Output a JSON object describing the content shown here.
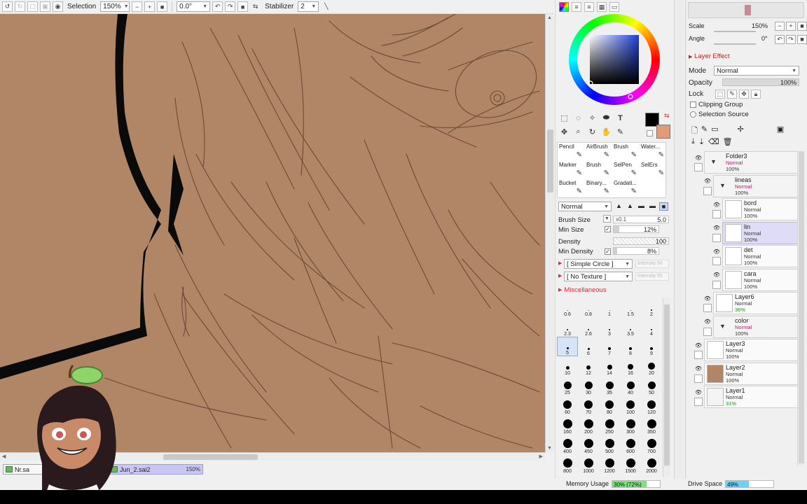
{
  "toolbar": {
    "selection_label": "Selection",
    "zoom_value": "150%",
    "rotation_value": "0.0°",
    "stabilizer_label": "Stabilizer",
    "stabilizer_value": "2"
  },
  "color_panel": {
    "fg_color": "#000000",
    "bg_color": "#e29a78",
    "canvas_color": "#b18667"
  },
  "brush_tools": [
    {
      "label": "Pencil"
    },
    {
      "label": "AirBrush"
    },
    {
      "label": "Brush"
    },
    {
      "label": "Water..."
    },
    {
      "label": "Marker"
    },
    {
      "label": "Brush"
    },
    {
      "label": "SelPen"
    },
    {
      "label": "SelErs"
    },
    {
      "label": "Bucket"
    },
    {
      "label": "Binary..."
    },
    {
      "label": "Gradati..."
    },
    {
      "label": ""
    }
  ],
  "brush_settings": {
    "blend_mode": "Normal",
    "brush_size_label": "Brush Size",
    "brush_size_multiplier": "x0.1",
    "brush_size_value": "5.0",
    "min_size_label": "Min Size",
    "min_size_value": "12%",
    "density_label": "Density",
    "density_value": "100",
    "min_density_label": "Min Density",
    "min_density_value": "8%",
    "shape_label": "[ Simple Circle ]",
    "shape_intensity": "Intensity 50",
    "texture_label": "[ No Texture ]",
    "texture_intensity": "Intensity 95",
    "misc_label": "Miscellaneous"
  },
  "brush_sizes": [
    {
      "label": "0.6",
      "d": 1
    },
    {
      "label": "0.8",
      "d": 1
    },
    {
      "label": "1",
      "d": 1
    },
    {
      "label": "1.5",
      "d": 1
    },
    {
      "label": "2",
      "d": 2
    },
    {
      "label": "2.3",
      "d": 2
    },
    {
      "label": "2.6",
      "d": 2
    },
    {
      "label": "3",
      "d": 2
    },
    {
      "label": "3.5",
      "d": 2
    },
    {
      "label": "4",
      "d": 2
    },
    {
      "label": "5",
      "d": 3
    },
    {
      "label": "6",
      "d": 3
    },
    {
      "label": "7",
      "d": 4
    },
    {
      "label": "8",
      "d": 4
    },
    {
      "label": "9",
      "d": 4
    },
    {
      "label": "10",
      "d": 5
    },
    {
      "label": "12",
      "d": 6
    },
    {
      "label": "14",
      "d": 7
    },
    {
      "label": "16",
      "d": 8
    },
    {
      "label": "20",
      "d": 10
    },
    {
      "label": "25",
      "d": 11
    },
    {
      "label": "30",
      "d": 11
    },
    {
      "label": "35",
      "d": 11
    },
    {
      "label": "40",
      "d": 11
    },
    {
      "label": "50",
      "d": 11
    },
    {
      "label": "60",
      "d": 12
    },
    {
      "label": "70",
      "d": 12
    },
    {
      "label": "80",
      "d": 12
    },
    {
      "label": "100",
      "d": 12
    },
    {
      "label": "120",
      "d": 12
    },
    {
      "label": "160",
      "d": 13
    },
    {
      "label": "200",
      "d": 13
    },
    {
      "label": "250",
      "d": 13
    },
    {
      "label": "300",
      "d": 13
    },
    {
      "label": "350",
      "d": 13
    },
    {
      "label": "400",
      "d": 13
    },
    {
      "label": "450",
      "d": 13
    },
    {
      "label": "500",
      "d": 13
    },
    {
      "label": "600",
      "d": 13
    },
    {
      "label": "700",
      "d": 13
    },
    {
      "label": "800",
      "d": 13
    },
    {
      "label": "1000",
      "d": 13
    },
    {
      "label": "1200",
      "d": 13
    },
    {
      "label": "1500",
      "d": 13
    },
    {
      "label": "2000",
      "d": 13
    }
  ],
  "navigator": {
    "scale_label": "Scale",
    "scale_value": "150%",
    "angle_label": "Angle",
    "angle_value": "0°"
  },
  "layer_props": {
    "layer_effect_label": "Layer Effect",
    "mode_label": "Mode",
    "mode_value": "Normal",
    "opacity_label": "Opacity",
    "opacity_value": "100%",
    "lock_label": "Lock",
    "clipping_label": "Clipping Group",
    "selection_source_label": "Selection Source"
  },
  "layers": [
    {
      "name": "Folder3",
      "mode": "Normal",
      "opacity": "100%",
      "folder": true,
      "selected": false
    },
    {
      "name": "lineas",
      "mode": "Normal",
      "opacity": "100%",
      "folder": true,
      "selected": false
    },
    {
      "name": "bord",
      "mode": "Normal",
      "opacity": "100%",
      "folder": false,
      "selected": false
    },
    {
      "name": "lin",
      "mode": "Normal",
      "opacity": "100%",
      "folder": false,
      "selected": true
    },
    {
      "name": "det",
      "mode": "Normal",
      "opacity": "100%",
      "folder": false,
      "selected": false
    },
    {
      "name": "cara",
      "mode": "Normal",
      "opacity": "100%",
      "folder": false,
      "selected": false
    },
    {
      "name": "Layer6",
      "mode": "Normal",
      "opacity": "36%",
      "folder": false,
      "selected": false
    },
    {
      "name": "color",
      "mode": "Normal",
      "opacity": "100%",
      "folder": true,
      "selected": false
    },
    {
      "name": "Layer3",
      "mode": "Normal",
      "opacity": "100%",
      "folder": false,
      "selected": false
    },
    {
      "name": "Layer2",
      "mode": "Normal",
      "opacity": "100%",
      "folder": false,
      "selected": false
    },
    {
      "name": "Layer1",
      "mode": "Normal",
      "opacity": "31%",
      "folder": false,
      "selected": false
    }
  ],
  "tabs": [
    {
      "name": "Nr.sa"
    },
    {
      "name": "Jun_2.sai2",
      "zoom": "150%"
    }
  ],
  "status": {
    "memory_label": "Memory Usage",
    "memory_value": "30% (72%)",
    "memory_fraction": 0.72,
    "drive_label": "Drive Space",
    "drive_value": "49%",
    "drive_fraction": 0.49
  }
}
